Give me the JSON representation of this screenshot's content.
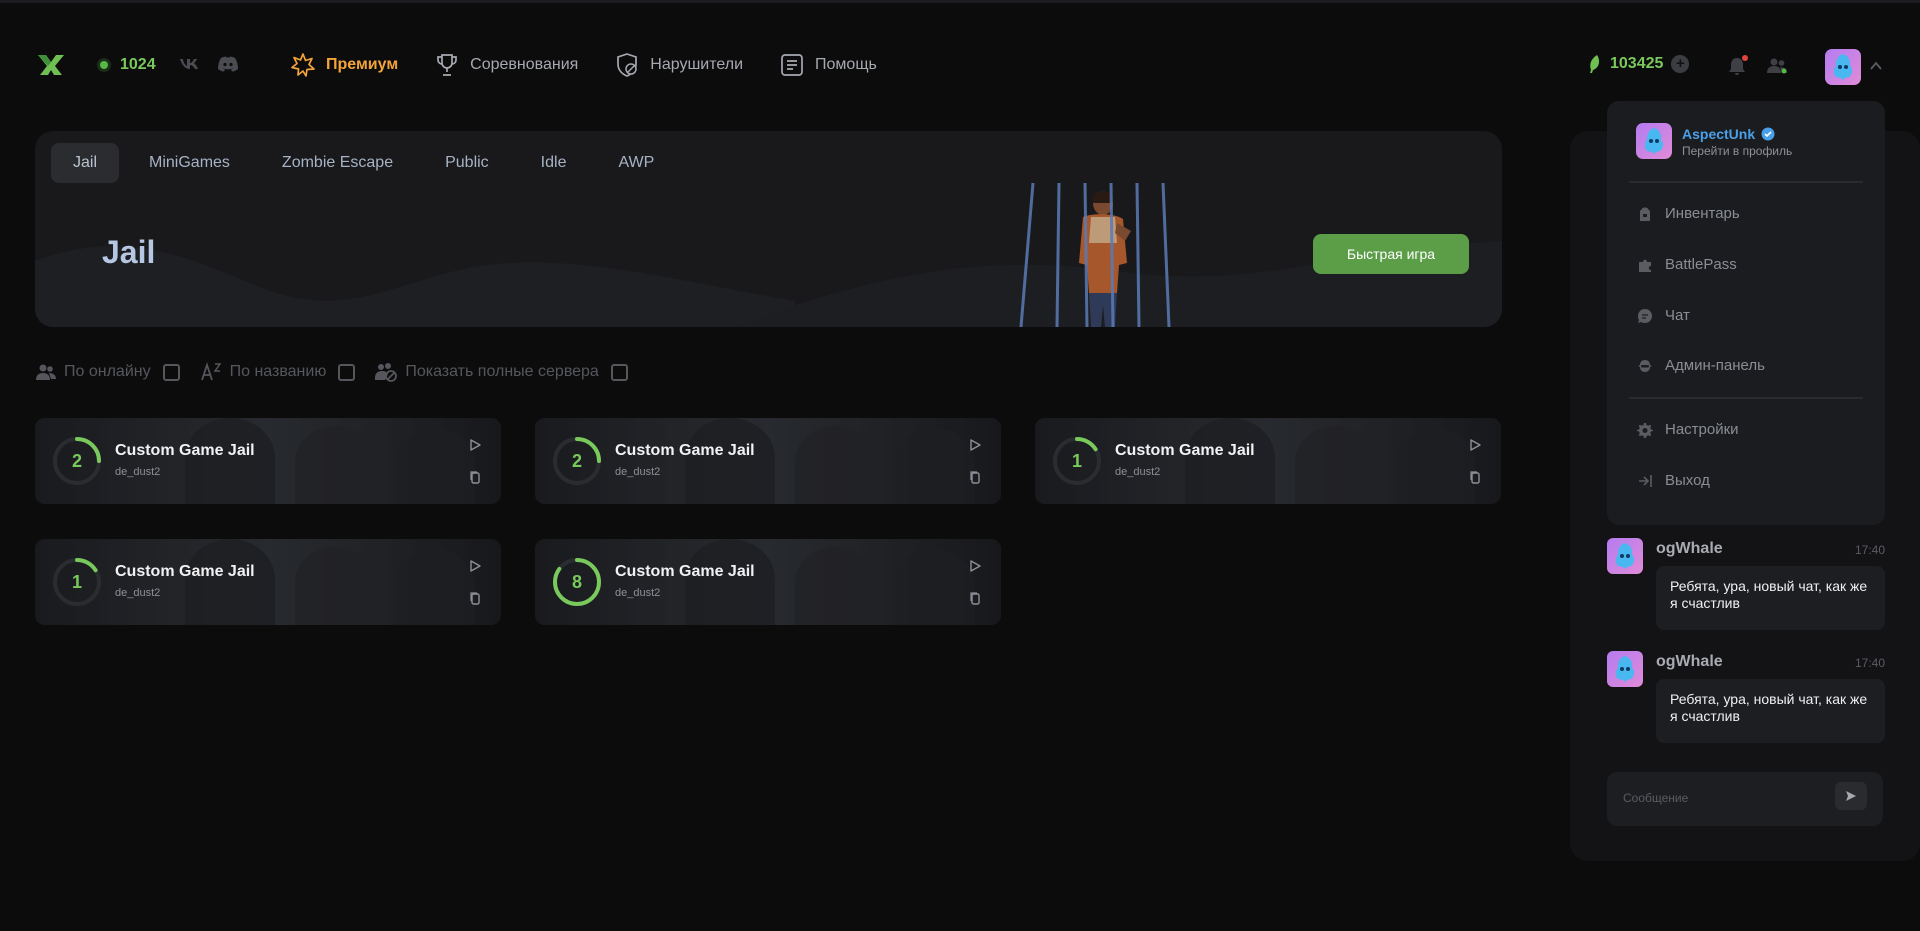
{
  "header": {
    "online_count": "1024",
    "nav": [
      {
        "label": "Премиум",
        "icon": "star-icon",
        "active": true
      },
      {
        "label": "Соревнования",
        "icon": "trophy-icon",
        "active": false
      },
      {
        "label": "Нарушители",
        "icon": "shield-icon",
        "active": false
      },
      {
        "label": "Помощь",
        "icon": "help-doc-icon",
        "active": false
      }
    ],
    "balance": "103425",
    "plus": "+"
  },
  "banner": {
    "tabs": [
      "Jail",
      "MiniGames",
      "Zombie Escape",
      "Public",
      "Idle",
      "AWP"
    ],
    "active_tab": "Jail",
    "title": "Jail",
    "quick_play_label": "Быстрая игра"
  },
  "filters": {
    "by_online": "По онлайну",
    "by_name": "По названию",
    "show_full": "Показать полные сервера"
  },
  "servers": [
    {
      "name": "Custom Game Jail",
      "map": "de_dust2",
      "players": "2",
      "fill": 0.25
    },
    {
      "name": "Custom Game Jail",
      "map": "de_dust2",
      "players": "2",
      "fill": 0.25
    },
    {
      "name": "Custom Game Jail",
      "map": "de_dust2",
      "players": "1",
      "fill": 0.16
    },
    {
      "name": "Custom Game Jail",
      "map": "de_dust2",
      "players": "1",
      "fill": 0.16
    },
    {
      "name": "Custom Game Jail",
      "map": "de_dust2",
      "players": "8",
      "fill": 0.85
    }
  ],
  "profile_menu": {
    "username": "AspectUnk",
    "profile_link": "Перейти в профиль",
    "items": [
      "Инвентарь",
      "BattlePass",
      "Чат",
      "Админ-панель"
    ],
    "settings": "Настройки",
    "logout": "Выход"
  },
  "chat": {
    "messages": [
      {
        "user": "ogWhale",
        "time": "17:40",
        "text": "Ребята, ура, новый чат, как же я счастлив"
      },
      {
        "user": "ogWhale",
        "time": "17:40",
        "text": "Ребята, ура, новый чат, как же я счастлив"
      }
    ],
    "input_placeholder": "Сообщение"
  },
  "colors": {
    "accent_green": "#79c95c",
    "premium_orange": "#f3a53b",
    "button_green": "#5c9e48",
    "link_blue": "#4aa0e8"
  }
}
